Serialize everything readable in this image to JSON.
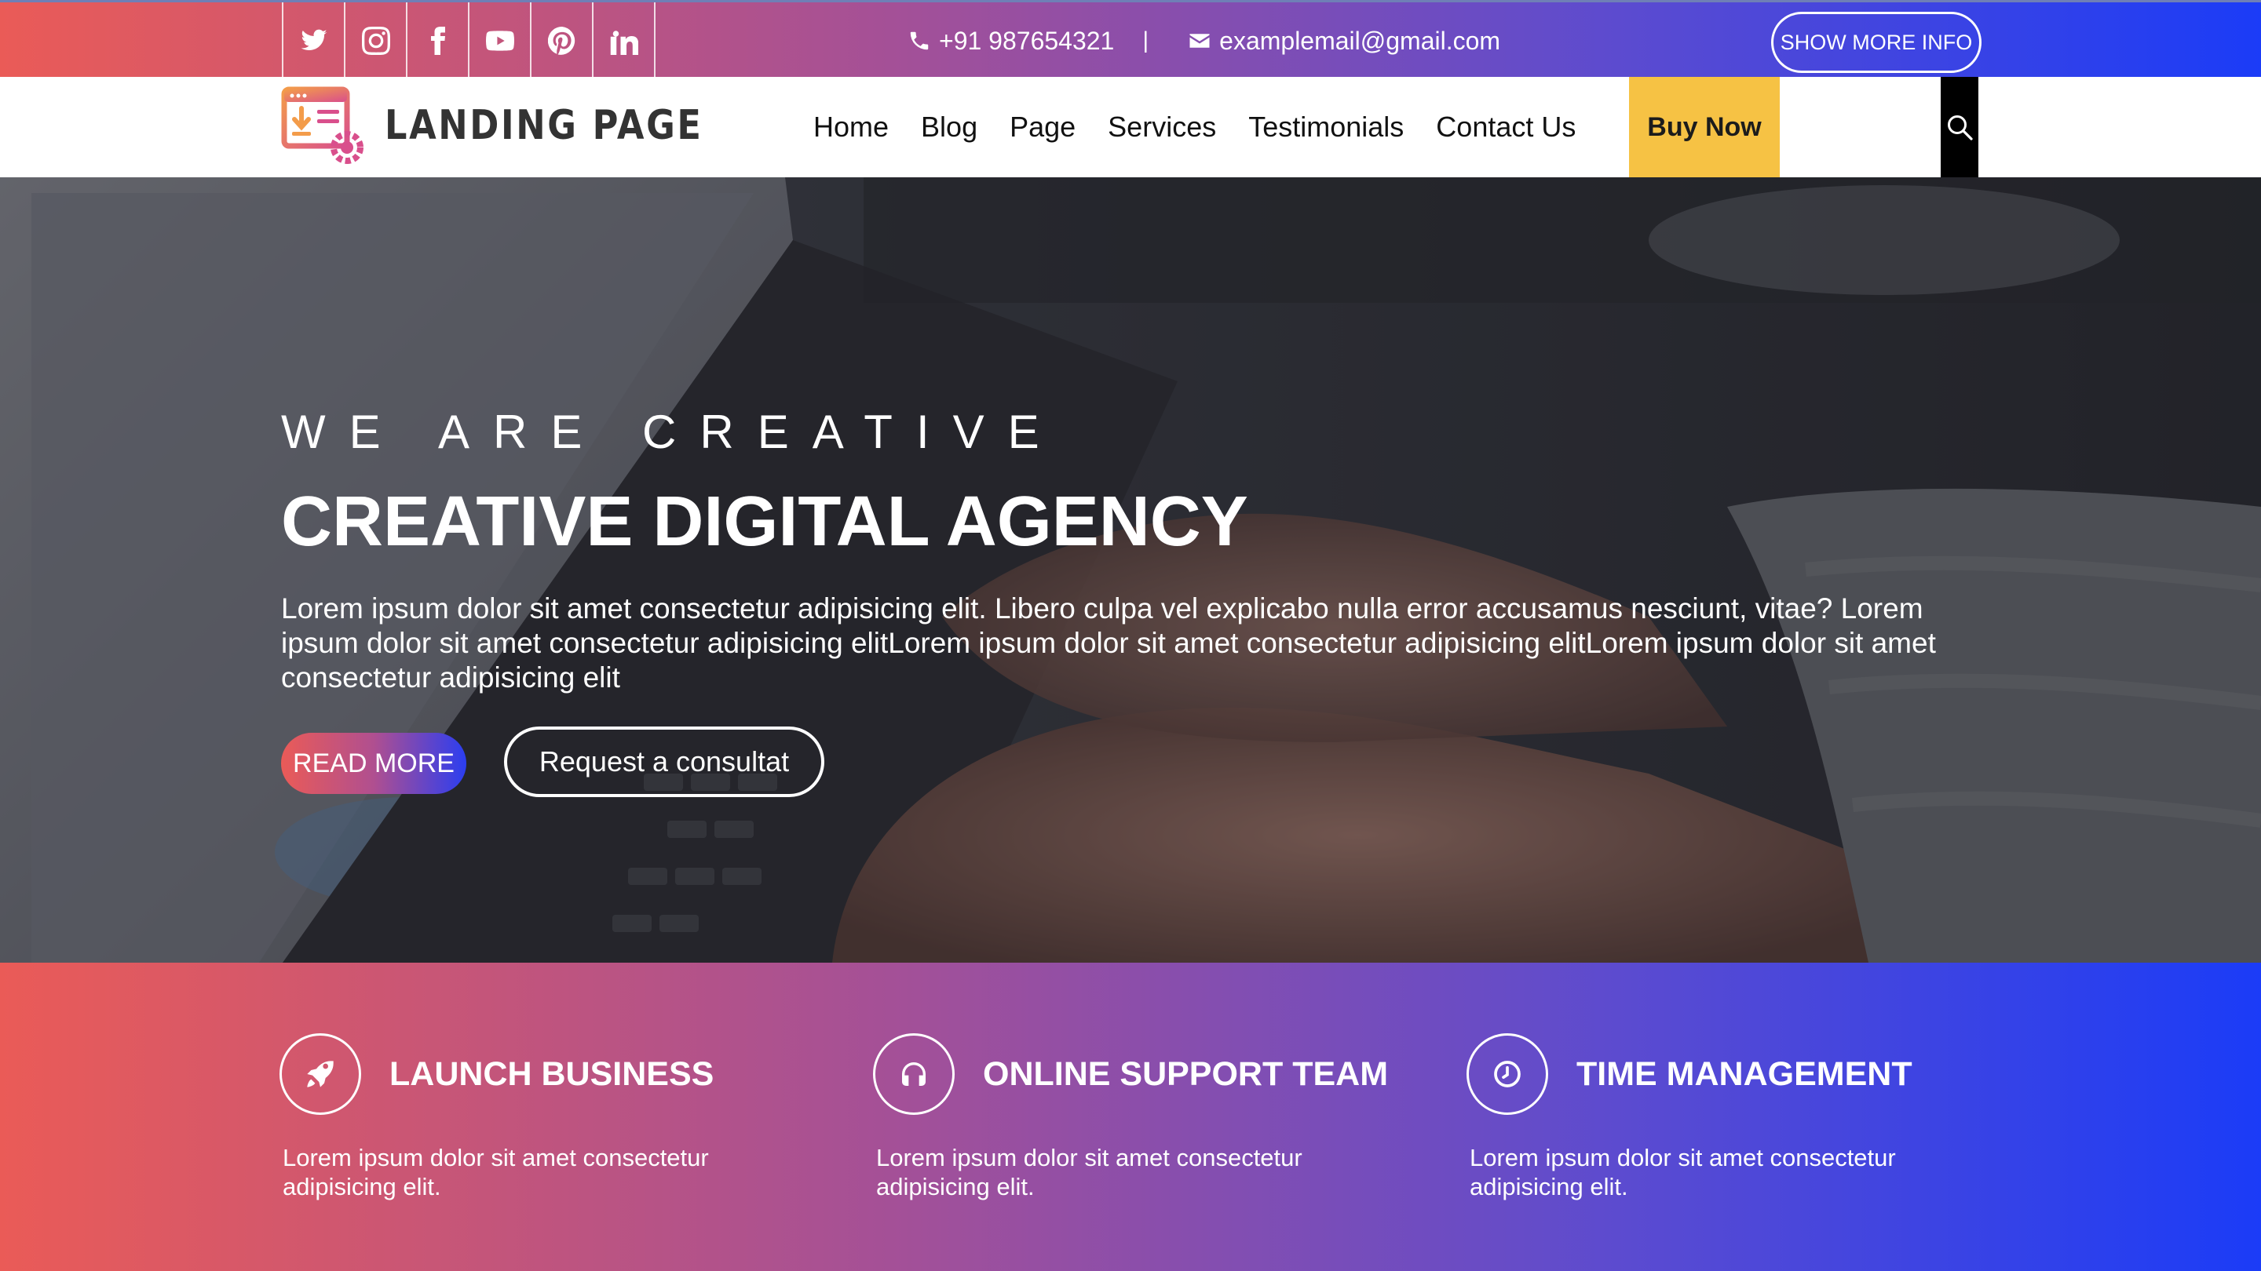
{
  "topbar": {
    "social": [
      {
        "name": "twitter-icon"
      },
      {
        "name": "instagram-icon"
      },
      {
        "name": "facebook-icon"
      },
      {
        "name": "youtube-icon"
      },
      {
        "name": "pinterest-icon"
      },
      {
        "name": "linkedin-icon"
      }
    ],
    "phone": "+91 987654321",
    "separator": "|",
    "email": "examplemail@gmail.com",
    "more_info_label": "SHOW MORE INFO"
  },
  "navbar": {
    "logo_text": "LANDING PAGE",
    "items": [
      "Home",
      "Blog",
      "Page",
      "Services",
      "Testimonials",
      "Contact Us"
    ],
    "buy_label": "Buy Now"
  },
  "hero": {
    "eyebrow": "WE ARE CREATIVE",
    "title": "CREATIVE DIGITAL AGENCY",
    "text": "Lorem ipsum dolor sit amet consectetur adipisicing elit. Libero culpa vel explicabo nulla error accusamus nesciunt, vitae? Lorem ipsum dolor sit amet consectetur adipisicing elitLorem ipsum dolor sit amet consectetur adipisicing elitLorem ipsum dolor sit amet consectetur adipisicing elit",
    "read_more_label": "READ MORE",
    "consult_label": "Request a consultat"
  },
  "features": [
    {
      "icon": "rocket-icon",
      "title": "LAUNCH BUSINESS",
      "text": "Lorem ipsum dolor sit amet consectetur adipisicing elit."
    },
    {
      "icon": "headphones-icon",
      "title": "ONLINE SUPPORT TEAM",
      "text": "Lorem ipsum dolor sit amet consectetur adipisicing elit."
    },
    {
      "icon": "clock-icon",
      "title": "TIME MANAGEMENT",
      "text": "Lorem ipsum dolor sit amet consectetur adipisicing elit."
    }
  ],
  "colors": {
    "gradient_start": "#ea5b57",
    "gradient_mid": "#a35098",
    "gradient_end": "#1b3cf7",
    "buy_button": "#f6c244",
    "search_button": "#000000"
  }
}
